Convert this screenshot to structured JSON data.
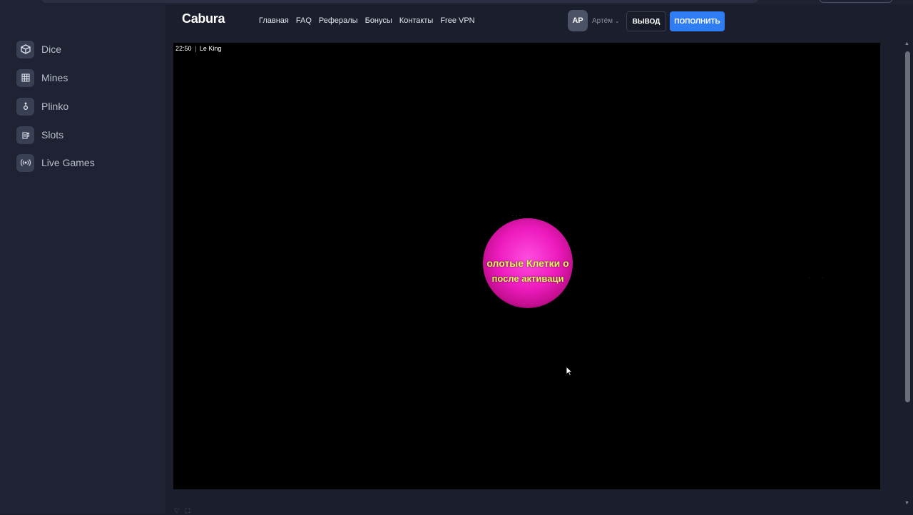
{
  "header": {
    "logo": "Cabura",
    "nav": [
      "Главная",
      "FAQ",
      "Рефералы",
      "Бонусы",
      "Контакты",
      "Free VPN"
    ],
    "avatar_initials": "АР",
    "user_name": "Артём",
    "withdraw_label": "ВЫВОД",
    "deposit_label": "ПОПОЛНИТЬ"
  },
  "sidebar": {
    "items": [
      {
        "label": "Dice",
        "icon": "dice-icon"
      },
      {
        "label": "Mines",
        "icon": "grid-icon"
      },
      {
        "label": "Plinko",
        "icon": "plinko-icon"
      },
      {
        "label": "Slots",
        "icon": "slots-icon"
      },
      {
        "label": "Live Games",
        "icon": "broadcast-icon"
      }
    ]
  },
  "game": {
    "time": "22:50",
    "title": "Le King",
    "orb_line_1": "олотые Клетки о",
    "orb_line_2": "после активаци"
  },
  "colors": {
    "background": "#1b1e2d",
    "sidebar": "#1e2233",
    "accent": "#2f7cf3",
    "orb": "#ee1bbf",
    "orb_text": "#f2f06a"
  }
}
